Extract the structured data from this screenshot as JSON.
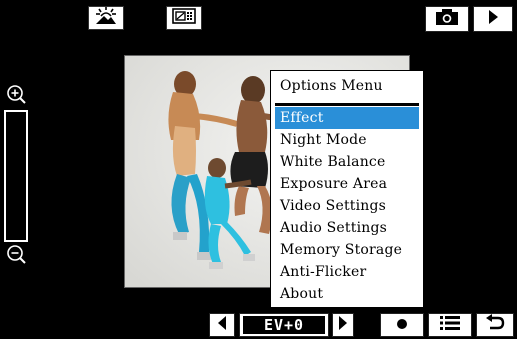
{
  "screen": {
    "background": "#000000"
  },
  "top_bar": {
    "scene_icon": "scene-mode-icon",
    "frame_icon": "frame-mode-icon",
    "camera_icon": "camera-icon",
    "play_icon": "play-icon"
  },
  "zoom": {
    "in_icon": "zoom-in-icon",
    "out_icon": "zoom-out-icon"
  },
  "options_menu": {
    "title": "Options Menu",
    "selected_color": "#2a8fd8",
    "items": [
      {
        "label": "Effect",
        "selected": true
      },
      {
        "label": "Night Mode",
        "selected": false
      },
      {
        "label": "White Balance",
        "selected": false
      },
      {
        "label": "Exposure Area",
        "selected": false
      },
      {
        "label": "Video Settings",
        "selected": false
      },
      {
        "label": "Audio Settings",
        "selected": false
      },
      {
        "label": "Memory Storage",
        "selected": false
      },
      {
        "label": "Anti-Flicker",
        "selected": false
      },
      {
        "label": "About",
        "selected": false
      }
    ]
  },
  "bottom_bar": {
    "ev_value": "EV+0",
    "left_icon": "chevron-left-icon",
    "right_icon": "chevron-right-icon",
    "record_icon": "record-icon",
    "list_icon": "list-icon",
    "back_icon": "back-arrow-icon"
  }
}
